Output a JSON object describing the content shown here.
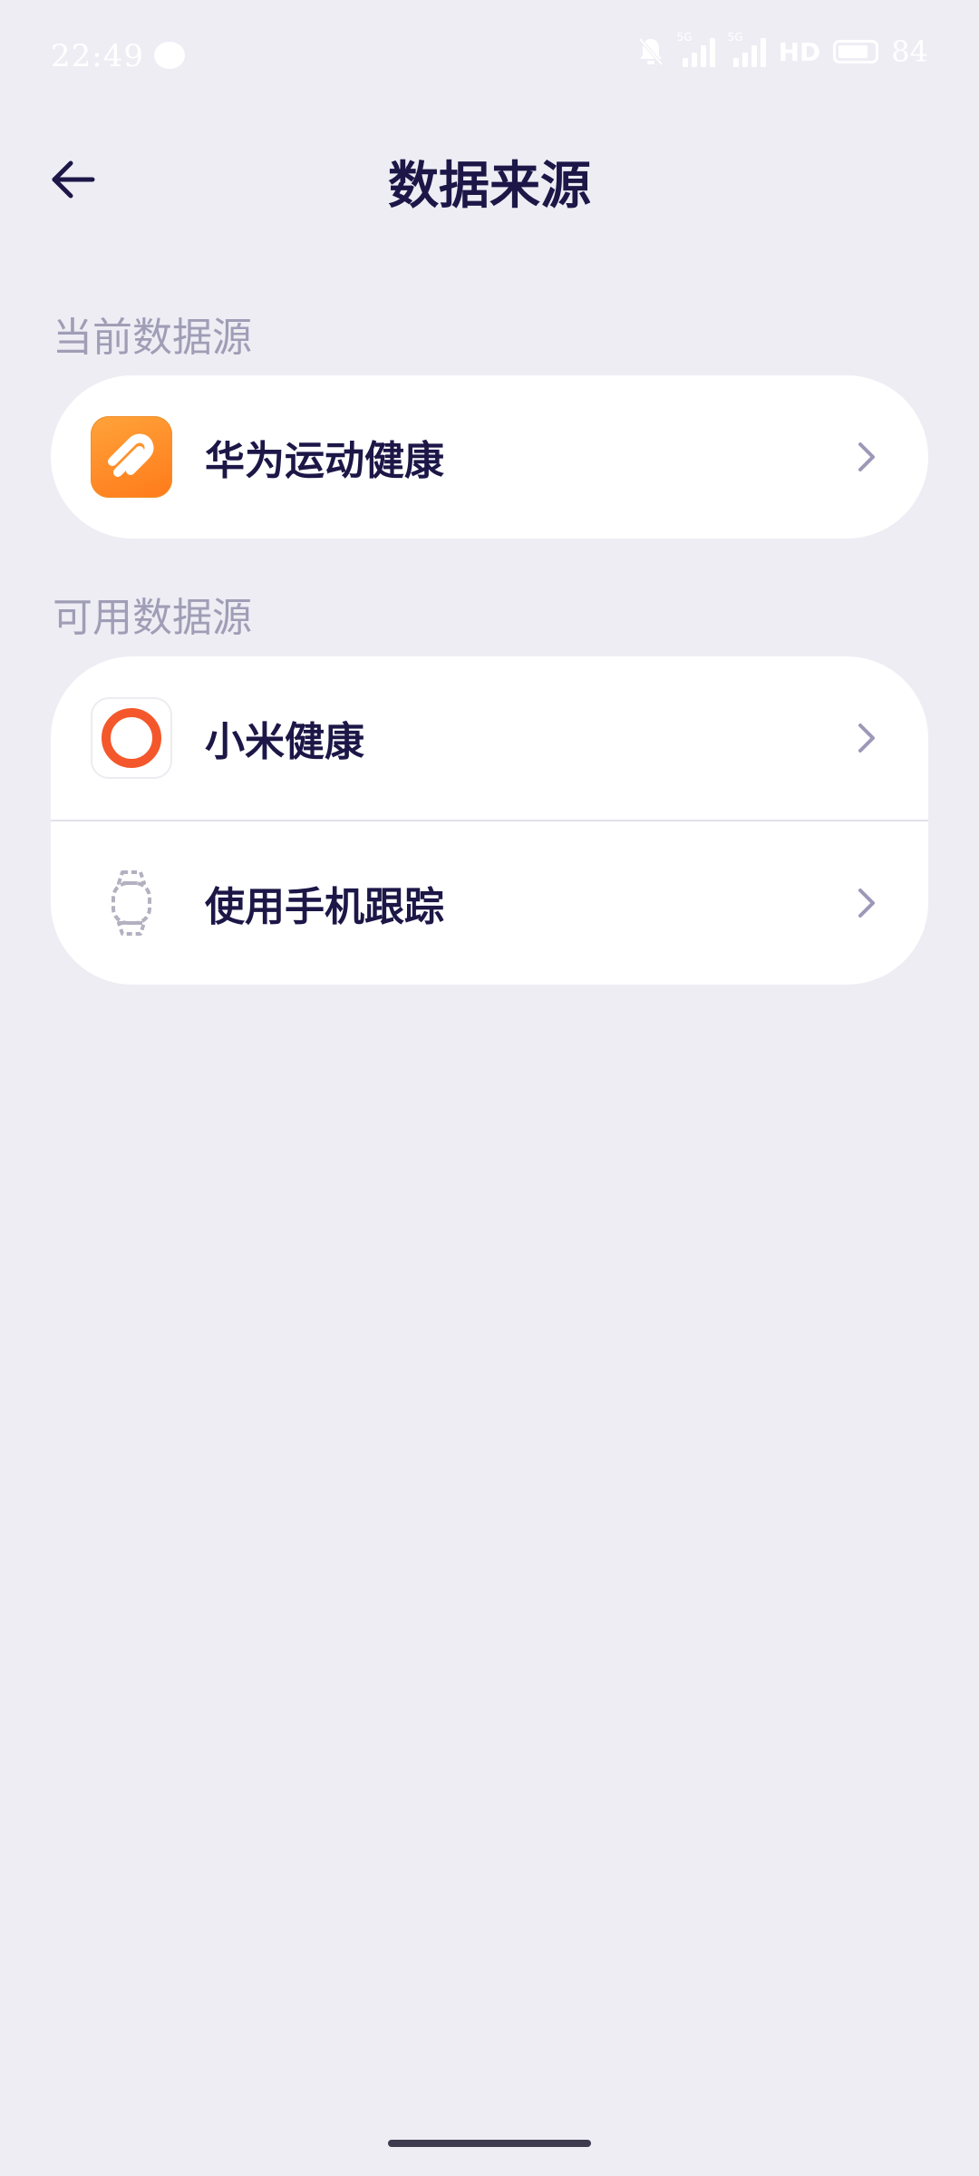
{
  "status_bar": {
    "time": "22:49",
    "network_tags": [
      "5G",
      "5G"
    ],
    "hd_label": "HD",
    "battery_level": "84"
  },
  "header": {
    "title": "数据来源"
  },
  "current_section": {
    "label": "当前数据源",
    "items": [
      {
        "label": "华为运动健康",
        "icon": "huawei-health-icon"
      }
    ]
  },
  "available_section": {
    "label": "可用数据源",
    "items": [
      {
        "label": "小米健康",
        "icon": "xiaomi-health-icon"
      },
      {
        "label": "使用手机跟踪",
        "icon": "watch-icon"
      }
    ]
  },
  "colors": {
    "background": "#eeedf4",
    "card": "#ffffff",
    "title_text": "#1c1747",
    "section_text": "#a09db6",
    "chevron": "#9c98b8",
    "huawei_orange": "#ff8c24",
    "xiaomi_red": "#f4572b"
  }
}
